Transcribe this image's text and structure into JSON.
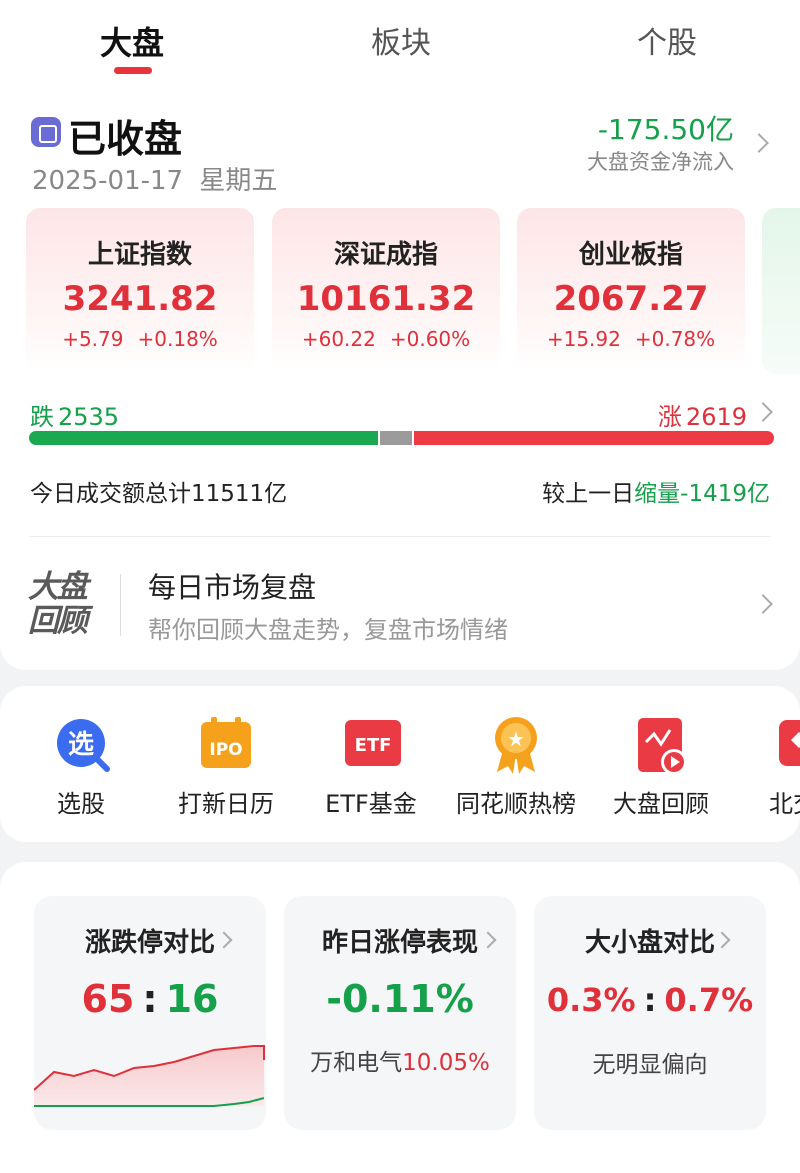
{
  "tabs": [
    {
      "label": "大盘",
      "active": true
    },
    {
      "label": "板块",
      "active": false
    },
    {
      "label": "个股",
      "active": false
    }
  ],
  "status": {
    "title": "已收盘",
    "date": "2025-01-17",
    "weekday": "星期五",
    "flow_value": "-175.50亿",
    "flow_label": "大盘资金净流入"
  },
  "indices": [
    {
      "name": "上证指数",
      "value": "3241.82",
      "change": "+5.79",
      "pct": "+0.18%"
    },
    {
      "name": "深证成指",
      "value": "10161.32",
      "change": "+60.22",
      "pct": "+0.60%"
    },
    {
      "name": "创业板指",
      "value": "2067.27",
      "change": "+15.92",
      "pct": "+0.78%"
    }
  ],
  "breadth": {
    "fall_label": "跌",
    "fall_count": "2535",
    "rise_label": "涨",
    "rise_count": "2619",
    "fall_fraction": 0.47,
    "flat_fraction": 0.04,
    "rise_fraction": 0.49
  },
  "turnover": {
    "total_text": "今日成交额总计11511亿",
    "compare_prefix": "较上一日",
    "compare_value": "缩量-1419亿"
  },
  "review": {
    "logo_line1": "大盘",
    "logo_line2": "回顾",
    "title": "每日市场复盘",
    "subtitle": "帮你回顾大盘走势，复盘市场情绪"
  },
  "shortcuts": [
    {
      "label": "选股",
      "icon": "stock-pick-icon",
      "glyph": "选",
      "color": "#3b6cf0"
    },
    {
      "label": "打新日历",
      "icon": "ipo-calendar-icon",
      "glyph": "IPO",
      "color": "#f5a11c"
    },
    {
      "label": "ETF基金",
      "icon": "etf-fund-icon",
      "glyph": "ETF",
      "color": "#ea3a44"
    },
    {
      "label": "同花顺热榜",
      "icon": "hot-list-icon",
      "glyph": "★",
      "color": "#f5a11c"
    },
    {
      "label": "大盘回顾",
      "icon": "market-review-icon",
      "glyph": "▶",
      "color": "#ea3a44"
    },
    {
      "label": "北交",
      "icon": "bse-icon",
      "glyph": "",
      "color": "#ea3a44"
    }
  ],
  "stats": {
    "limit": {
      "title": "涨跌停对比",
      "up": "65",
      "sep": ":",
      "down": "16"
    },
    "yesterday": {
      "title": "昨日涨停表现",
      "value": "-0.11%",
      "stock_name": "万和电气",
      "stock_pct": "10.05%"
    },
    "size": {
      "title": "大小盘对比",
      "left": "0.3%",
      "sep": ":",
      "right": "0.7%",
      "note": "无明显偏向"
    }
  }
}
